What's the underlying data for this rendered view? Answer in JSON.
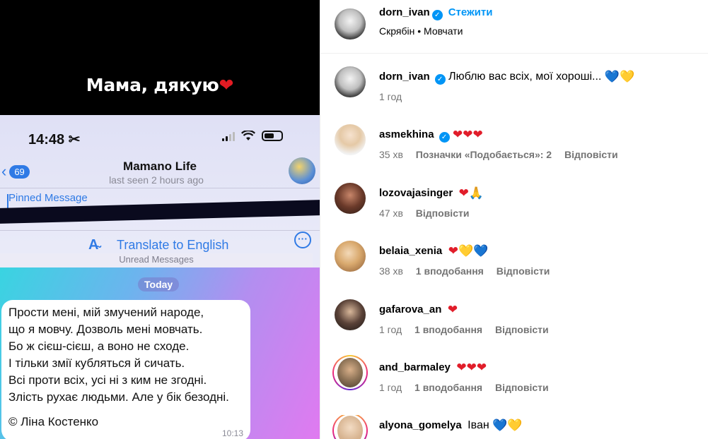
{
  "media": {
    "caption": "Мама, дякую",
    "caption_emoji": "❤",
    "phone": {
      "time": "14:48",
      "time_icon": "✂",
      "back_count": "69",
      "chat_title": "Mamano Life",
      "chat_subtitle": "last seen 2 hours ago",
      "pinned_label": "Pinned Message",
      "translate_label": "Translate to English",
      "unread_label": "Unread Messages",
      "today_label": "Today",
      "message_lines": [
        "Прости мені, мій змучений народе,",
        "що я мовчу. Дозволь мені мовчать.",
        "Бо ж сієш-сієш, а воно не сходе.",
        "І тільки змії кубляться й сичать.",
        "Всі проти всіх, усі ні з ким не згодні.",
        "Злість рухає людьми. Але у бік безодні."
      ],
      "message_author": "© Ліна Костенко",
      "message_time": "10:13",
      "battery_level": 0.58
    }
  },
  "post": {
    "username": "dorn_ivan",
    "follow_label": "Стежити",
    "audio": "Скрябін",
    "audio_sep": "•",
    "audio_track": "Мовчати"
  },
  "comments": [
    {
      "username": "dorn_ivan",
      "text": "Люблю вас всіх, мої хороші...",
      "emoji": [
        "💙",
        "💛"
      ],
      "time": "1 год",
      "likes": "",
      "reply": ""
    },
    {
      "username": "asmekhina",
      "text": "",
      "emoji": [
        "❤",
        "❤",
        "❤"
      ],
      "time": "35 хв",
      "likes": "Позначки «Подобається»: 2",
      "reply": "Відповісти"
    },
    {
      "username": "lozovajasinger",
      "text": "",
      "emoji": [
        "❤",
        "🙏"
      ],
      "time": "47 хв",
      "likes": "",
      "reply": "Відповісти"
    },
    {
      "username": "belaia_xenia",
      "text": "",
      "emoji": [
        "❤",
        "💛",
        "💙"
      ],
      "time": "38 хв",
      "likes": "1 вподобання",
      "reply": "Відповісти"
    },
    {
      "username": "gafarova_an",
      "text": "",
      "emoji": [
        "❤"
      ],
      "time": "1 год",
      "likes": "1 вподобання",
      "reply": "Відповісти"
    },
    {
      "username": "and_barmaley",
      "text": "",
      "emoji": [
        "❤",
        "❤",
        "❤"
      ],
      "time": "1 год",
      "likes": "1 вподобання",
      "reply": "Відповісти"
    },
    {
      "username": "alyona_gomelya",
      "text": "Іван",
      "emoji": [
        "💙",
        "💛"
      ],
      "time": "",
      "likes": "",
      "reply": ""
    }
  ],
  "colors": {
    "accent_blue": "#0095f6",
    "heart_red": "#e11d2a",
    "heart_blue": "#1a6fe0",
    "heart_yellow": "#f4cf13"
  }
}
